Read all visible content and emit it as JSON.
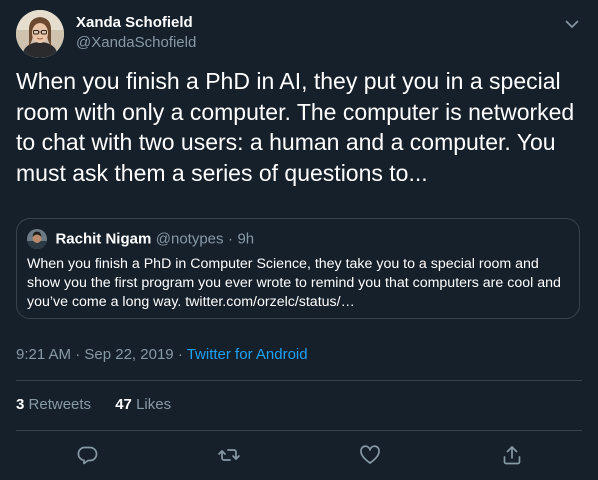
{
  "author": {
    "name": "Xanda Schofield",
    "handle": "@XandaSchofield"
  },
  "tweet": {
    "text": "When you finish a PhD in AI, they put you in a special room with only a computer. The computer is networked to chat with two users: a human and a computer. You must ask them a series of questions to..."
  },
  "quoted": {
    "name": "Rachit Nigam",
    "handle": "@notypes",
    "separator": "·",
    "time": "9h",
    "text": "When you finish a PhD in Computer Science, they take you to a special room and show you the first program you ever wrote to remind you that computers are cool and you’ve come a long way. twitter.com/orzelc/status/…"
  },
  "meta": {
    "time": "9:21 AM",
    "separator1": "·",
    "date": "Sep 22, 2019",
    "separator2": "·",
    "source": "Twitter for Android"
  },
  "stats": {
    "retweets_count": "3",
    "retweets_label": "Retweets",
    "likes_count": "47",
    "likes_label": "Likes"
  },
  "icons": {
    "caret": "chevron-down-icon",
    "reply": "reply-icon",
    "retweet": "retweet-icon",
    "like": "heart-icon",
    "share": "share-icon"
  },
  "colors": {
    "background": "#15202b",
    "secondary_text": "#8899a6",
    "link": "#1da1f2",
    "border": "#38444d"
  }
}
